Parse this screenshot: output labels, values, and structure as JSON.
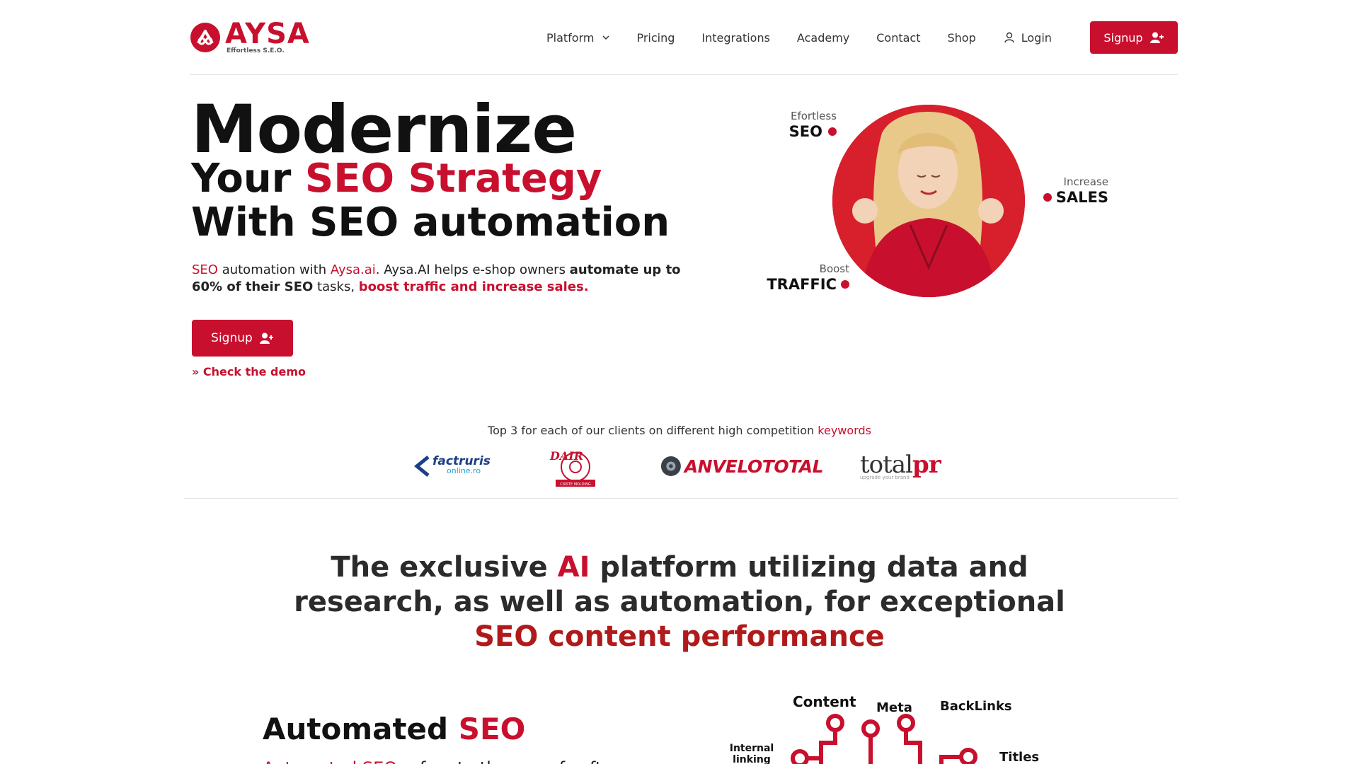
{
  "header": {
    "logo_text": "AYSA",
    "logo_tagline": "Effortless S.E.O.",
    "nav": [
      {
        "label": "Platform"
      },
      {
        "label": "Pricing"
      },
      {
        "label": "Integrations"
      },
      {
        "label": "Academy"
      },
      {
        "label": "Contact"
      },
      {
        "label": "Shop"
      },
      {
        "label": "Login"
      }
    ],
    "signup_label": "Signup"
  },
  "hero": {
    "title": "Modernize",
    "line2_prefix": "Your ",
    "line2_accent": "SEO Strategy",
    "line3": "With SEO automation",
    "desc": {
      "p1_accent": "SEO",
      "p2": " automation with ",
      "p3_accent": "Aysa.ai",
      "p4": ". Aysa.AI helps e-shop owners ",
      "p5_bold": "automate up to 60% of their SEO",
      "p6": " tasks, ",
      "p7_accent_bold": "boost traffic and increase sales."
    },
    "signup_label": "Signup",
    "demo_link": "» Check the demo",
    "labels": {
      "seo_small": "Efortless",
      "seo_big": "SEO",
      "traffic_small": "Boost",
      "traffic_big": "TRAFFIC",
      "sales_small": "Increase",
      "sales_big": "SALES"
    }
  },
  "clients": {
    "caption_prefix": "Top 3 for each of our clients on different high competition ",
    "caption_accent": "keywords",
    "logos": [
      {
        "name": "factruris",
        "text1": "factruris",
        "text2": "online.ro"
      },
      {
        "name": "dair",
        "text1": "DAIR",
        "text2": "CIRSTE MOLDING"
      },
      {
        "name": "anvelototal",
        "text1": "ANVELOTOTAL"
      },
      {
        "name": "totalpr",
        "text1": "total",
        "text2": "pr",
        "text3": "upgrade your brand"
      }
    ]
  },
  "section": {
    "title_p1": "The exclusive ",
    "title_accent": "AI",
    "title_p2": " platform utilizing data and research, as well as automation, for exceptional",
    "title_sub": "SEO content performance"
  },
  "automated": {
    "title_prefix": "Automated ",
    "title_accent": "SEO",
    "sub_accent": "Automated SEO",
    "sub_rest": " refers to the use of soft"
  },
  "diagram": {
    "labels": [
      "Content",
      "Meta",
      "BackLinks",
      "Internal linking",
      "Titles"
    ]
  },
  "colors": {
    "accent": "#c8102e",
    "accent_dark": "#b01a1a",
    "text": "#1a1a1a"
  }
}
